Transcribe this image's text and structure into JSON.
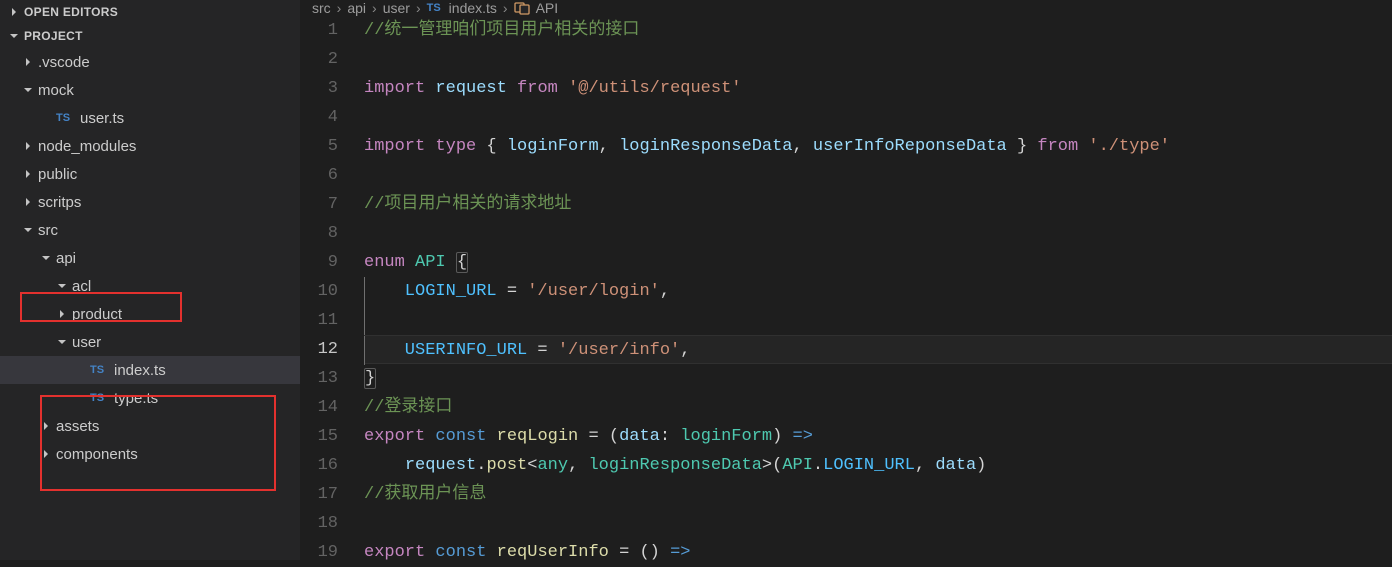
{
  "sidebar": {
    "open_editors_label": "OPEN EDITORS",
    "project_label": "PROJECT",
    "tree": [
      {
        "label": ".vscode",
        "chev": "right",
        "indent": 20
      },
      {
        "label": "mock",
        "chev": "down",
        "indent": 20
      },
      {
        "label": "user.ts",
        "chev": "none",
        "file": "TS",
        "indent": 38
      },
      {
        "label": "node_modules",
        "chev": "right",
        "indent": 20
      },
      {
        "label": "public",
        "chev": "right",
        "indent": 20
      },
      {
        "label": "scritps",
        "chev": "right",
        "indent": 20
      },
      {
        "label": "src",
        "chev": "down",
        "indent": 20
      },
      {
        "label": "api",
        "chev": "down",
        "indent": 38
      },
      {
        "label": "acl",
        "chev": "down",
        "indent": 54
      },
      {
        "label": "product",
        "chev": "right",
        "indent": 54
      },
      {
        "label": "user",
        "chev": "down",
        "indent": 54,
        "open": true
      },
      {
        "label": "index.ts",
        "chev": "none",
        "file": "TS",
        "indent": 72,
        "selected": true
      },
      {
        "label": "type.ts",
        "chev": "none",
        "file": "TS",
        "indent": 72
      },
      {
        "label": "assets",
        "chev": "right",
        "indent": 38
      },
      {
        "label": "components",
        "chev": "right",
        "indent": 38
      }
    ]
  },
  "breadcrumb": {
    "parts": [
      "src",
      "api",
      "user"
    ],
    "file_tag": "TS",
    "file": "index.ts",
    "symbol": "API"
  },
  "code": {
    "lines": [
      {
        "n": 1,
        "t": [
          [
            "comment",
            "//统一管理咱们项目用户相关的接口"
          ]
        ]
      },
      {
        "n": 2,
        "t": []
      },
      {
        "n": 3,
        "t": [
          [
            "keyword",
            "import"
          ],
          [
            "punct",
            " "
          ],
          [
            "ident",
            "request"
          ],
          [
            "punct",
            " "
          ],
          [
            "keyword",
            "from"
          ],
          [
            "punct",
            " "
          ],
          [
            "string",
            "'@/utils/request'"
          ]
        ]
      },
      {
        "n": 4,
        "t": []
      },
      {
        "n": 5,
        "t": [
          [
            "keyword",
            "import"
          ],
          [
            "punct",
            " "
          ],
          [
            "keyword",
            "type"
          ],
          [
            "punct",
            " { "
          ],
          [
            "ident",
            "loginForm"
          ],
          [
            "punct",
            ", "
          ],
          [
            "ident",
            "loginResponseData"
          ],
          [
            "punct",
            ", "
          ],
          [
            "ident",
            "userInfoReponseData"
          ],
          [
            "punct",
            " } "
          ],
          [
            "keyword",
            "from"
          ],
          [
            "punct",
            " "
          ],
          [
            "string",
            "'./type'"
          ]
        ]
      },
      {
        "n": 6,
        "t": []
      },
      {
        "n": 7,
        "t": [
          [
            "comment",
            "//项目用户相关的请求地址"
          ]
        ]
      },
      {
        "n": 8,
        "t": []
      },
      {
        "n": 9,
        "t": [
          [
            "keyword",
            "enum"
          ],
          [
            "punct",
            " "
          ],
          [
            "type",
            "API"
          ],
          [
            "punct",
            " "
          ],
          [
            "punct_open",
            "{"
          ]
        ]
      },
      {
        "n": 10,
        "t": [
          [
            "enumkey",
            "    LOGIN_URL"
          ],
          [
            "punct",
            " = "
          ],
          [
            "string",
            "'/user/login'"
          ],
          [
            "punct",
            ","
          ]
        ]
      },
      {
        "n": 11,
        "t": []
      },
      {
        "n": 12,
        "t": [
          [
            "enumkey",
            "    USERINFO_URL"
          ],
          [
            "punct",
            " = "
          ],
          [
            "string",
            "'/user/info'"
          ],
          [
            "punct",
            ","
          ]
        ],
        "cur": true
      },
      {
        "n": 13,
        "t": [
          [
            "punct_close",
            "}"
          ]
        ]
      },
      {
        "n": 14,
        "t": [
          [
            "comment",
            "//登录接口"
          ]
        ]
      },
      {
        "n": 15,
        "t": [
          [
            "keyword",
            "export"
          ],
          [
            "punct",
            " "
          ],
          [
            "const",
            "const"
          ],
          [
            "punct",
            " "
          ],
          [
            "func",
            "reqLogin"
          ],
          [
            "punct",
            " "
          ],
          [
            "op",
            "="
          ],
          [
            "punct",
            " ("
          ],
          [
            "ident",
            "data"
          ],
          [
            "punct",
            ": "
          ],
          [
            "type",
            "loginForm"
          ],
          [
            "punct",
            ") "
          ],
          [
            "const",
            "=>"
          ]
        ]
      },
      {
        "n": 16,
        "t": [
          [
            "punct",
            "    "
          ],
          [
            "ident",
            "request"
          ],
          [
            "punct",
            "."
          ],
          [
            "func",
            "post"
          ],
          [
            "punct",
            "<"
          ],
          [
            "type",
            "any"
          ],
          [
            "punct",
            ", "
          ],
          [
            "type",
            "loginResponseData"
          ],
          [
            "punct",
            ">("
          ],
          [
            "type",
            "API"
          ],
          [
            "punct",
            "."
          ],
          [
            "enumkey",
            "LOGIN_URL"
          ],
          [
            "punct",
            ", "
          ],
          [
            "ident",
            "data"
          ],
          [
            "punct",
            ")"
          ]
        ]
      },
      {
        "n": 17,
        "t": [
          [
            "comment",
            "//获取用户信息"
          ]
        ]
      },
      {
        "n": 18,
        "t": []
      },
      {
        "n": 19,
        "t": [
          [
            "keyword",
            "export"
          ],
          [
            "punct",
            " "
          ],
          [
            "const",
            "const"
          ],
          [
            "punct",
            " "
          ],
          [
            "func",
            "reqUserInfo"
          ],
          [
            "punct",
            " "
          ],
          [
            "op",
            "="
          ],
          [
            "punct",
            " () "
          ],
          [
            "const",
            "=>"
          ]
        ]
      }
    ]
  }
}
